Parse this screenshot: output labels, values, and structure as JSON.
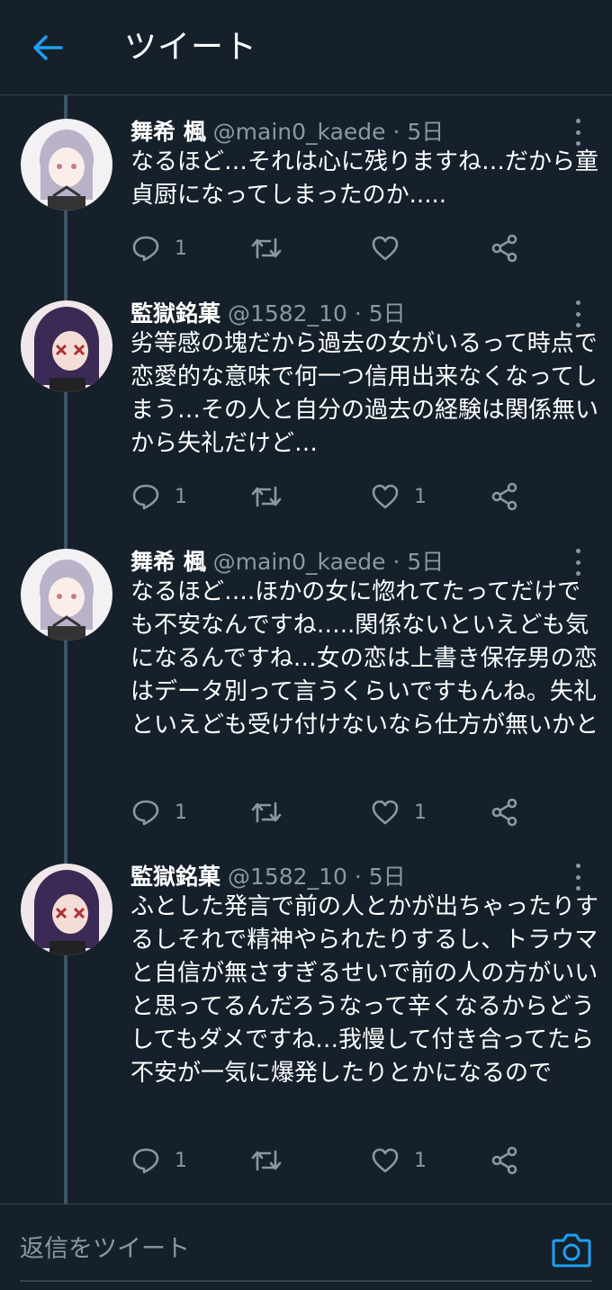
{
  "header": {
    "title": "ツイート",
    "back_icon": "arrow-left-icon"
  },
  "colors": {
    "background": "#15202b",
    "accent": "#1da1f2",
    "muted": "#8899a6",
    "thread_line": "#3d5466"
  },
  "tweets": [
    {
      "name": "舞希 楓",
      "handle": "@main0_kaede",
      "dot": "·",
      "age": "5日",
      "text": "なるほど…それは心に残りますね…だから童貞厨になってしまったのか.....",
      "reply_count": "1",
      "like_count": ""
    },
    {
      "name": "監獄銘菓",
      "handle": "@1582_10",
      "dot": "·",
      "age": "5日",
      "text": "劣等感の塊だから過去の女がいるって時点で恋愛的な意味で何一つ信用出来なくなってしまう…その人と自分の過去の経験は関係無いから失礼だけど…",
      "reply_count": "1",
      "like_count": "1"
    },
    {
      "name": "舞希 楓",
      "handle": "@main0_kaede",
      "dot": "·",
      "age": "5日",
      "text": "なるほど….ほかの女に惚れてたってだけでも不安なんですね…..関係ないといえども気になるんですね…女の恋は上書き保存男の恋はデータ別って言うくらいですもんね。失礼といえども受け付けないなら仕方が無いかと",
      "reply_count": "1",
      "like_count": "1"
    },
    {
      "name": "監獄銘菓",
      "handle": "@1582_10",
      "dot": "·",
      "age": "5日",
      "text": "ふとした発言で前の人とかが出ちゃったりするしそれで精神やられたりするし、トラウマと自信が無さすぎるせいで前の人の方がいいと思ってるんだろうなって辛くなるからどうしてもダメですね…我慢して付き合ってたら不安が一気に爆発したりとかになるので",
      "reply_count": "1",
      "like_count": "1"
    }
  ],
  "reply_bar": {
    "placeholder": "返信をツイート",
    "camera_icon": "camera-icon"
  }
}
